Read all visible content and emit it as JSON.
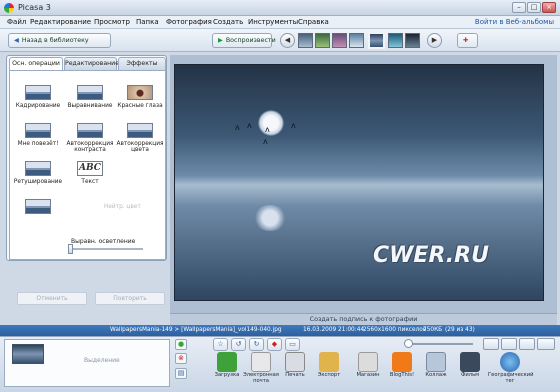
{
  "window": {
    "title": "Picasa 3"
  },
  "menu": {
    "items": [
      "Файл",
      "Редактирование",
      "Просмотр",
      "Папка",
      "Фотография",
      "Создать",
      "Инструменты",
      "Справка"
    ],
    "signin": "Войти в Веб-альбомы"
  },
  "toolbar": {
    "back_label": "Назад в библиотеку",
    "play_label": "Воспроизвести"
  },
  "edit_panel": {
    "tabs": [
      "Осн. операции",
      "Редактирование",
      "Эффекты"
    ],
    "active_tab": "Осн. операции",
    "tools": [
      {
        "label": "Кадрирование",
        "icon": "crop-icon"
      },
      {
        "label": "Выравнивание",
        "icon": "straighten-icon"
      },
      {
        "label": "Красные глаза",
        "icon": "redeye-icon"
      },
      {
        "label": "Мне повезёт!",
        "icon": "feeling-lucky-icon"
      },
      {
        "label": "Автокоррекция контраста",
        "icon": "auto-contrast-icon"
      },
      {
        "label": "Автокоррекция цвета",
        "icon": "auto-color-icon"
      },
      {
        "label": "Ретуширование",
        "icon": "retouch-icon"
      },
      {
        "label": "Текст",
        "icon": "text-icon",
        "glyph": "ABC"
      }
    ],
    "hidden_option": "Нейтр. цвет",
    "fill_light_label": "Выравн. осветление",
    "fill_light_value": 0,
    "undo_label": "Отменить",
    "redo_label": "Повторить"
  },
  "photo": {
    "caption_placeholder": "Создать подпись к фотографии",
    "watermark": "CWER.RU"
  },
  "status": {
    "path": "WallpapersMania-149 > [WallpapersMania]_vol149-040.jpg",
    "date": "16.03.2009 21:00:44",
    "dimensions": "2560x1600 пикселов",
    "size": "750КБ",
    "position": "(29 из 43)"
  },
  "tray": {
    "selection_label": "Выделение",
    "actions": [
      {
        "label": "Загрузка",
        "icon": "upload-icon",
        "color": "#3fa13a"
      },
      {
        "label": "Электронная почта",
        "icon": "email-icon",
        "color": "#e8e8ea"
      },
      {
        "label": "Печать",
        "icon": "print-icon",
        "color": "#d9dce2"
      },
      {
        "label": "Экспорт",
        "icon": "export-icon",
        "color": "#e0b34c"
      },
      {
        "label": "Магазин",
        "icon": "shop-icon",
        "color": "#dcdcdc"
      },
      {
        "label": "BlogThis!",
        "icon": "blogger-icon",
        "color": "#f07a19"
      },
      {
        "label": "Коллаж",
        "icon": "collage-icon",
        "color": "#b7c6d9"
      },
      {
        "label": "Фильм",
        "icon": "movie-icon",
        "color": "#3a4a5c"
      },
      {
        "label": "Географический тег",
        "icon": "geotag-icon",
        "color": "#3c7ac8"
      }
    ]
  },
  "colors": {
    "status_bar": "#3f79bc",
    "accent": "#2a62b4"
  }
}
